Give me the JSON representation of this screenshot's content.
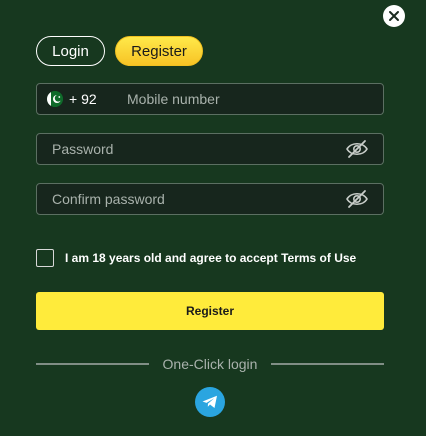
{
  "tabs": {
    "login_label": "Login",
    "register_label": "Register",
    "active": "register"
  },
  "phone": {
    "country_code": "+ 92",
    "placeholder": "Mobile number",
    "flag": "pakistan-flag"
  },
  "password": {
    "placeholder": "Password"
  },
  "confirm_password": {
    "placeholder": "Confirm password"
  },
  "agreement": {
    "text": "I am 18 years old and agree to accept Terms of Use",
    "checked": false
  },
  "register_button": {
    "label": "Register"
  },
  "one_click": {
    "label": "One-Click login"
  },
  "icons": {
    "close": "close-icon",
    "eye_off": "eye-off-icon",
    "telegram": "telegram-icon"
  },
  "colors": {
    "background": "#17381f",
    "accent": "#ffeb3b",
    "telegram": "#2aa5e0"
  }
}
